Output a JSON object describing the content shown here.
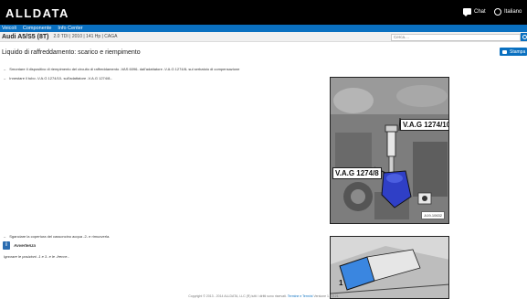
{
  "app": {
    "logo": "ALLDATA"
  },
  "header": {
    "chat_label": "Chat",
    "language_label": "Italiano"
  },
  "nav": {
    "items": [
      "Veicoli",
      "Componente",
      "Info Center"
    ]
  },
  "vehicle": {
    "name": "Audi A5/S5 (8T)",
    "details": "2.0 TDI | 2010 | 141 Hp | CAGA"
  },
  "search": {
    "placeholder": "Cerca...."
  },
  "page": {
    "title": "Liquido di raffreddamento: scarico e riempimento",
    "print_label": "Stampa"
  },
  "steps": [
    "Smontare il dispositivo di riempimento del circuito di raffreddamento -VAS 6096- dall'adattatore -V.A.G 1274/8- sul serbatoio di compensazione",
    "Innestare il tubo -V.A.G 1274/10- sull'adattatore -V.A.G 1274/8-.",
    "Sganciare la copertura del cassoncino acqua -2- e rimuoverla."
  ],
  "warning": {
    "title": "Avvertenza",
    "text": "Ignorare le posizioni -1 e 3- e le -frecce-."
  },
  "figures": {
    "fig1": {
      "callout_top": "V.A.G 1274/10",
      "callout_bottom": "V.A.G 1274/8",
      "code": "A19-10632"
    },
    "fig2": {
      "label": "1"
    }
  },
  "footer": {
    "text": "Copyright © 2013 - 2014 ALLDATA, LLC (R) tutti i diritti sono riservati.",
    "terms": "Termine e Termini",
    "version": "Versione 1.0.0.21"
  },
  "colors": {
    "topbar": "#000000",
    "nav": "#0a70c0",
    "accent": "#0a70c0"
  }
}
